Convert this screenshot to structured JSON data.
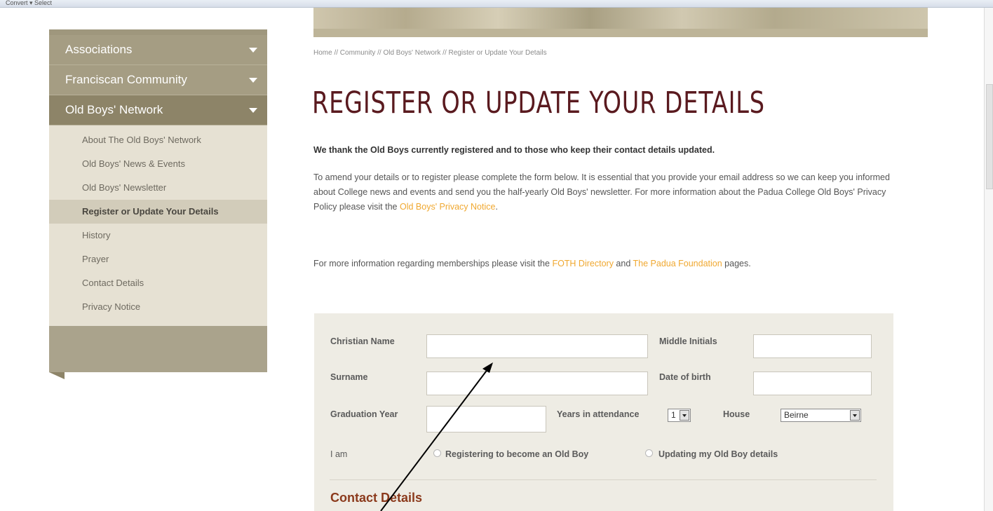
{
  "toolbar": {
    "text": "Convert ▾ Select"
  },
  "sidebar": {
    "sections": [
      {
        "label": "Associations"
      },
      {
        "label": "Franciscan Community"
      },
      {
        "label": "Old Boys' Network"
      }
    ],
    "sub_items": [
      {
        "label": "About The Old Boys' Network"
      },
      {
        "label": "Old Boys' News & Events"
      },
      {
        "label": "Old Boys' Newsletter"
      },
      {
        "label": "Register or Update Your Details"
      },
      {
        "label": "History"
      },
      {
        "label": "Prayer"
      },
      {
        "label": "Contact Details"
      },
      {
        "label": "Privacy Notice"
      }
    ]
  },
  "breadcrumb": "Home // Community // Old Boys' Network // Register or Update Your Details",
  "page_title": "REGISTER OR UPDATE YOUR DETAILS",
  "intro_bold": "We thank the Old Boys currently registered and to those who keep their contact details updated.",
  "paragraph1": {
    "text": "To amend your details or to register please complete the form below. It is essential that you provide your email address so we can keep you informed about College news and events and send you the half-yearly Old Boys' newsletter. For more information about the Padua College Old Boys' Privacy Policy please visit the ",
    "link": "Old Boys' Privacy Notice",
    "end": "."
  },
  "paragraph2": {
    "before": "For more information regarding memberships please visit the ",
    "link1": "FOTH Directory",
    "mid": " and ",
    "link2": "The Padua Foundation",
    "after": " pages."
  },
  "form": {
    "christian_name": "Christian Name",
    "middle_initials": "Middle Initials",
    "surname": "Surname",
    "date_of_birth": "Date of birth",
    "graduation_year": "Graduation Year",
    "years_in_attendance": "Years in attendance",
    "years_value": "1",
    "house": "House",
    "house_value": "Beirne",
    "i_am": "I am",
    "option_register": "Registering to become an Old Boy",
    "option_update": "Updating my Old Boy details",
    "contact_heading": "Contact Details"
  },
  "colors": {
    "title": "#5a1a1f",
    "link": "#f0a830",
    "sidebar_header": "#a59d83",
    "sidebar_active": "#8d8468",
    "sidebar_sub_bg": "#e6e1d3",
    "form_bg": "#eeece4",
    "contact_heading": "#8b3a1c"
  },
  "annotation": {
    "icon": "arrow-pointer-icon"
  }
}
